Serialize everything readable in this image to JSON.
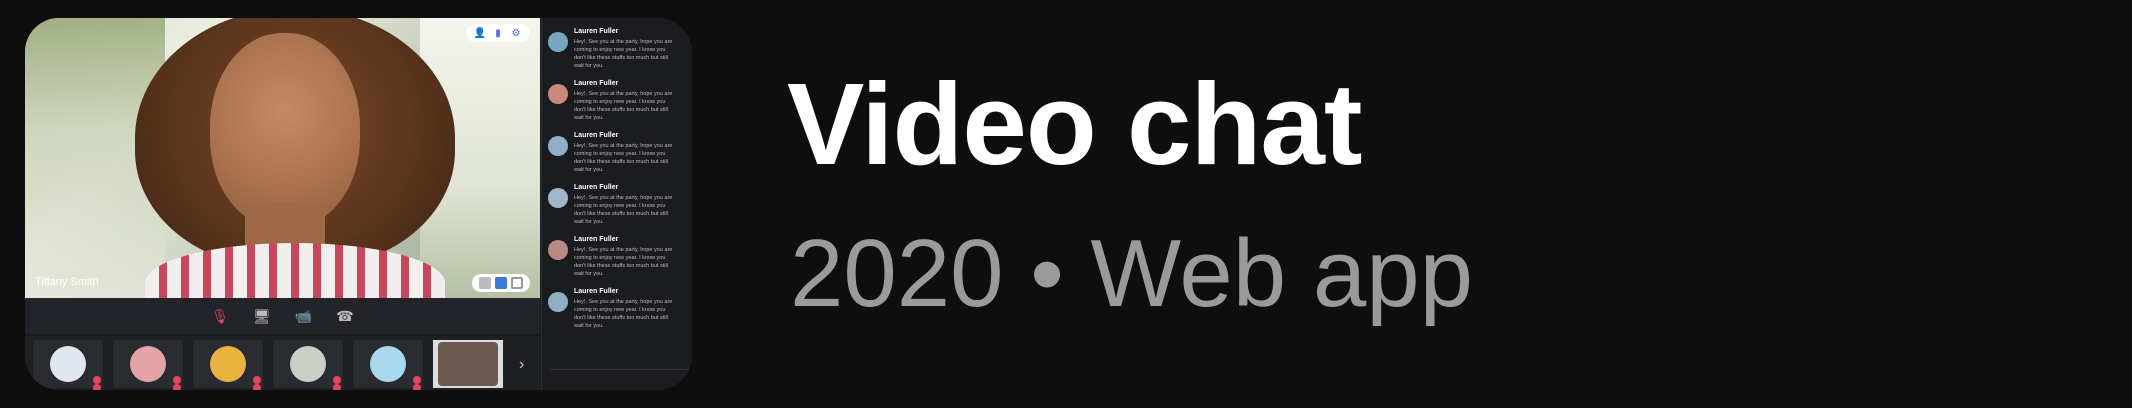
{
  "title": "Video chat",
  "subtitle": "2020 • Web app",
  "colors": {
    "background": "#0e0e0e",
    "panel": "#1b1c1f",
    "accent_red": "#e0475a"
  },
  "main_video": {
    "participant_name": "Tiffany Smith"
  },
  "top_icons": [
    "add-person-icon",
    "chat-badge-icon",
    "settings-icon"
  ],
  "controls": [
    "mic-muted-icon",
    "screen-share-icon",
    "camera-off-icon",
    "phone-icon"
  ],
  "chat": {
    "messages": [
      {
        "name": "Lauren Fuller",
        "text": "Hey!, See you at the party, hope you are coming to enjoy new year. I know you don't like these stuffs too much but still wait for you."
      },
      {
        "name": "Lauren Fuller",
        "text": "Hey!, See you at the party, hope you are coming to enjoy new year. I know you don't like these stuffs too much but still wait for you."
      },
      {
        "name": "Lauren Fuller",
        "text": "Hey!, See you at the party, hope you are coming to enjoy new year. I know you don't like these stuffs too much but still wait for you."
      },
      {
        "name": "Lauren Fuller",
        "text": "Hey!, See you at the party, hope you are coming to enjoy new year. I know you don't like these stuffs too much but still wait for you."
      },
      {
        "name": "Lauren Fuller",
        "text": "Hey!, See you at the party, hope you are coming to enjoy new year. I know you don't like these stuffs too much but still wait for you."
      },
      {
        "name": "Lauren Fuller",
        "text": "Hey!, See you at the party, hope you are coming to enjoy new year. I know you don't like these stuffs too much but still wait for you."
      }
    ]
  }
}
